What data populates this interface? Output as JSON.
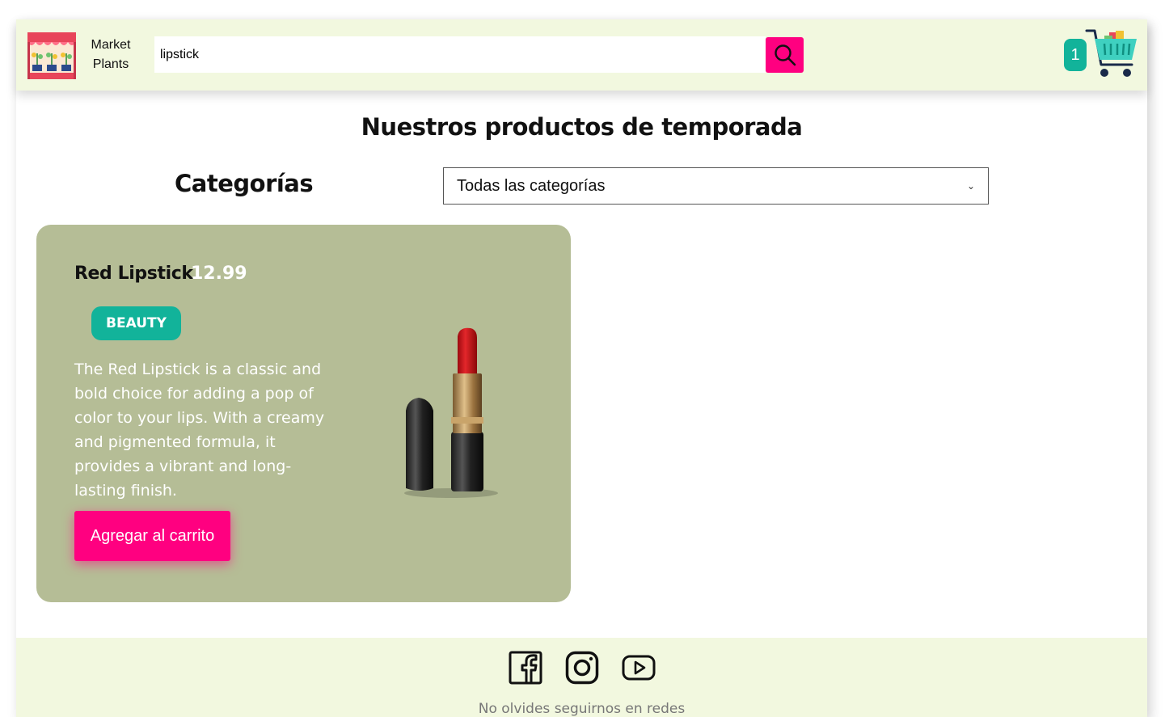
{
  "header": {
    "brand_line1": "Market",
    "brand_line2": "Plants",
    "search_value": "lipstick",
    "cart_count": "1"
  },
  "main": {
    "title": "Nuestros productos de temporada",
    "categories_label": "Categorías",
    "category_selected": "Todas las categorías"
  },
  "product": {
    "name": "Red Lipstick",
    "price": "12.99",
    "category": "BEAUTY",
    "description": "The Red Lipstick is a classic and bold choice for adding a pop of color to your lips. With a creamy and pigmented formula, it provides a vibrant and long-lasting finish.",
    "add_button": "Agregar al carrito"
  },
  "footer": {
    "text": "No olvides seguirnos en redes"
  },
  "colors": {
    "header_bg": "#f2f8df",
    "accent_pink": "#ff0080",
    "accent_teal": "#12b39a",
    "card_bg": "#b5bd96"
  },
  "icons": [
    "shop-logo-icon",
    "search-icon",
    "shopping-cart-icon",
    "lipstick-image",
    "facebook-icon",
    "instagram-icon",
    "youtube-icon",
    "chevron-down-icon"
  ]
}
